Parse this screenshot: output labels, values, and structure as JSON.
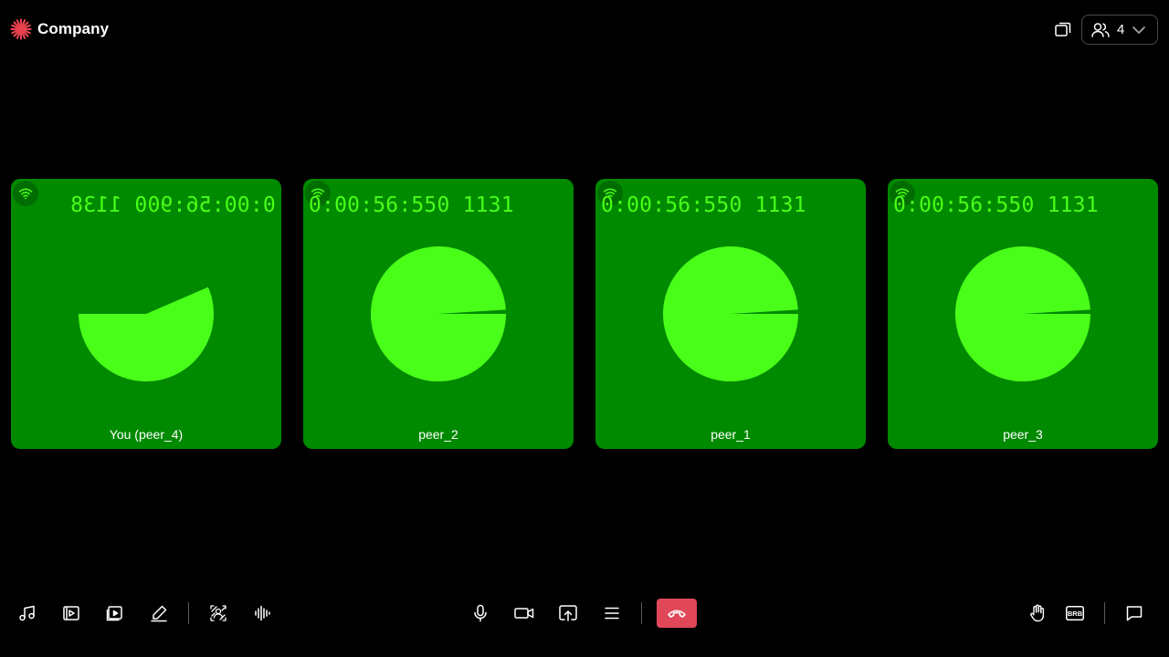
{
  "header": {
    "brand": "Company",
    "brand_color": "#e8424f",
    "layout_icon": "layout-icon",
    "participants": {
      "icon": "people-icon",
      "count": "4",
      "chevron_icon": "chevron-down-icon"
    }
  },
  "tiles": [
    {
      "timer": "0:00:56:900 1138",
      "mirrored": true,
      "name": "You (peer_4)",
      "pie_filled_fraction": 0.57,
      "network_icon": "wifi-icon"
    },
    {
      "timer": "0:00:56:550 1131",
      "mirrored": false,
      "name": "peer_2",
      "pie_filled_fraction": 0.99,
      "network_icon": "wifi-icon"
    },
    {
      "timer": "0:00:56:550 1131",
      "mirrored": false,
      "name": "peer_1",
      "pie_filled_fraction": 0.99,
      "network_icon": "wifi-icon"
    },
    {
      "timer": "0:00:56:550 1131",
      "mirrored": false,
      "name": "peer_3",
      "pie_filled_fraction": 0.99,
      "network_icon": "wifi-icon"
    }
  ],
  "colors": {
    "tile_background": "#008a00",
    "pie_color": "#49ff19",
    "leave_button": "#e0485a"
  },
  "toolbar": {
    "left": [
      "music-icon",
      "video-play-icon",
      "video-file-icon",
      "whiteboard-pen-icon",
      "virtual-background-icon",
      "audio-waveform-icon"
    ],
    "center": [
      "microphone-icon",
      "camera-icon",
      "screen-share-icon",
      "menu-icon"
    ],
    "leave": "hangup-icon",
    "right": [
      "raise-hand-icon",
      "brb-icon",
      "chat-icon"
    ],
    "brb_label": "BRB"
  }
}
